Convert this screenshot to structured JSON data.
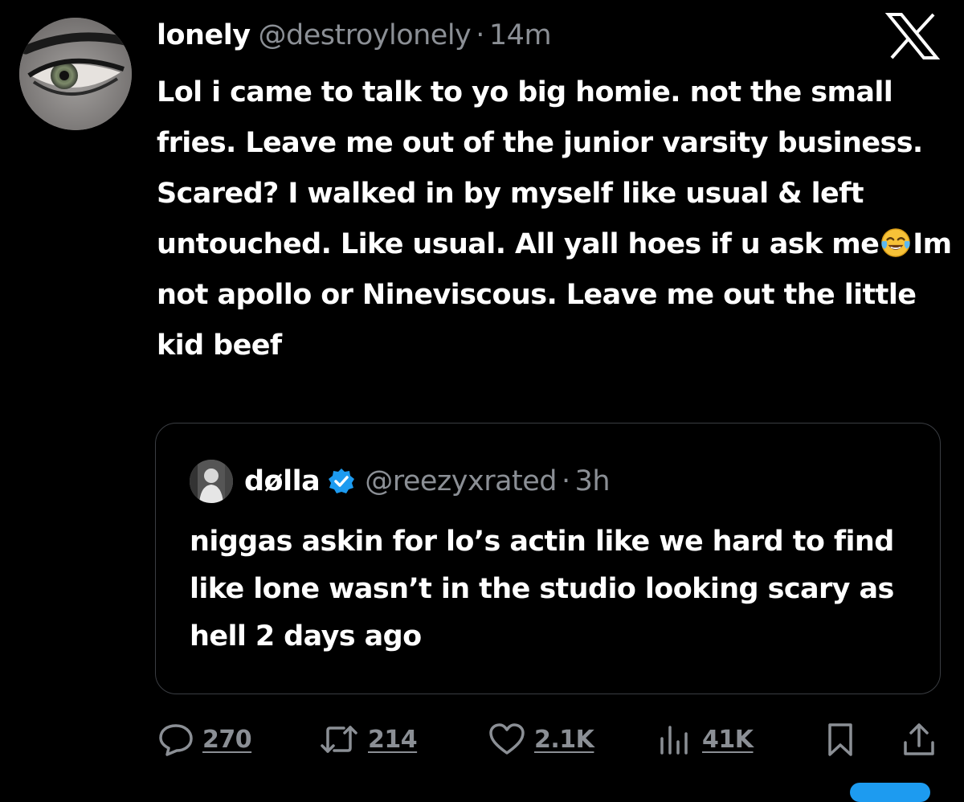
{
  "post": {
    "author_name": "lonely",
    "author_handle": "@destroylonely",
    "separator": "·",
    "time": "14m",
    "text_before_emoji": "Lol i came to talk to yo big homie. not the small fries. Leave me out of the junior varsity business. Scared? I walked in by myself like usual & left untouched. Like usual. All yall hoes if u ask me",
    "emoji": "face-with-tears-of-joy",
    "text_after_emoji": "Im not apollo or Nineviscous. Leave me out the little kid beef"
  },
  "quoted_post": {
    "author_name": "døllа",
    "verified": true,
    "author_handle": "@reezyxrated",
    "separator": "·",
    "time": "3h",
    "text": "niggas askin for lo’s actin like we hard to find like lone wasn’t in the studio looking scary as hell 2 days ago"
  },
  "metrics": {
    "replies": "270",
    "reposts": "214",
    "likes": "2.1K",
    "views": "41K"
  },
  "icons": {
    "platform": "x-logo",
    "reply": "speech-bubble-icon",
    "repost": "repost-arrows-icon",
    "like": "heart-icon",
    "views": "bar-chart-icon",
    "bookmark": "bookmark-icon",
    "share": "share-upload-icon"
  },
  "colors": {
    "background": "#000000",
    "text": "#ffffff",
    "secondary_text": "#8b8f95",
    "card_border": "#3a3d42",
    "verified_badge": "#1d9bf0"
  }
}
